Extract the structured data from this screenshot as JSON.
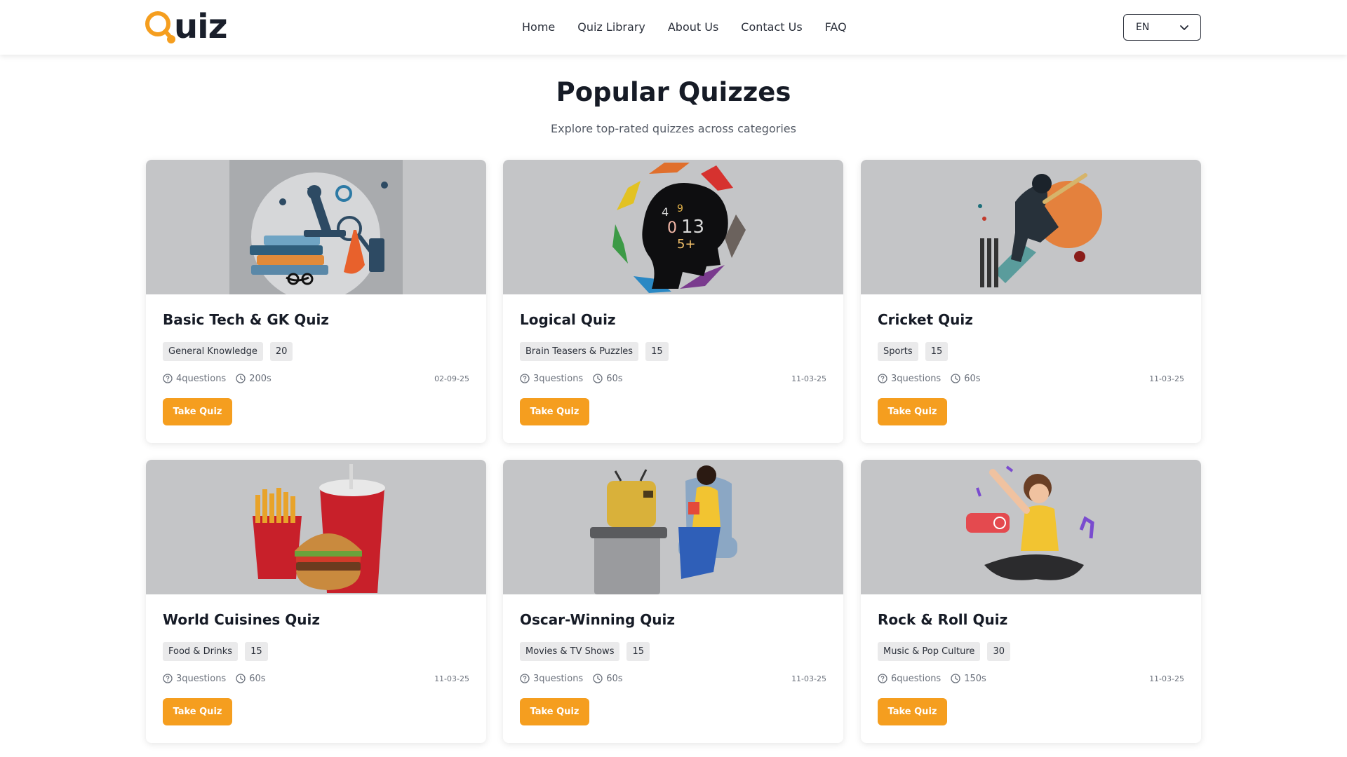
{
  "header": {
    "logo_text": "uiz",
    "logo_brand": "Quiz",
    "nav": [
      "Home",
      "Quiz Library",
      "About Us",
      "Contact Us",
      "FAQ"
    ],
    "language": "EN",
    "accent_color": "#f59e1f"
  },
  "main": {
    "title": "Popular Quizzes",
    "subtitle": "Explore top-rated quizzes across categories",
    "cards": [
      {
        "title": "Basic Tech & GK Quiz",
        "category": "General Knowledge",
        "points": "20",
        "questions": "4questions",
        "time": "200s",
        "date": "02-09-25",
        "button": "Take Quiz",
        "image": "science-tech-illustration"
      },
      {
        "title": "Logical Quiz",
        "category": "Brain Teasers & Puzzles",
        "points": "15",
        "questions": "3questions",
        "time": "60s",
        "date": "11-03-25",
        "button": "Take Quiz",
        "image": "head-numbers-illustration"
      },
      {
        "title": "Cricket Quiz",
        "category": "Sports",
        "points": "15",
        "questions": "3questions",
        "time": "60s",
        "date": "11-03-25",
        "button": "Take Quiz",
        "image": "cricket-batsman-illustration"
      },
      {
        "title": "World Cuisines Quiz",
        "category": "Food & Drinks",
        "points": "15",
        "questions": "3questions",
        "time": "60s",
        "date": "11-03-25",
        "button": "Take Quiz",
        "image": "burger-fries-drink-illustration"
      },
      {
        "title": "Oscar-Winning Quiz",
        "category": "Movies & TV Shows",
        "points": "15",
        "questions": "3questions",
        "time": "60s",
        "date": "11-03-25",
        "button": "Take Quiz",
        "image": "person-watching-tv-illustration"
      },
      {
        "title": "Rock & Roll Quiz",
        "category": "Music & Pop Culture",
        "points": "30",
        "questions": "6questions",
        "time": "150s",
        "date": "11-03-25",
        "button": "Take Quiz",
        "image": "person-listening-music-illustration"
      }
    ]
  }
}
